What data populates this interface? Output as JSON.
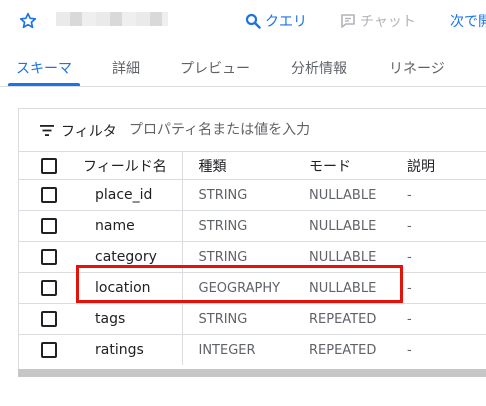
{
  "toolbar": {
    "query_label": "クエリ",
    "chat_label": "チャット",
    "next_label": "次で開く"
  },
  "tabs": [
    {
      "label": "スキーマ",
      "active": true
    },
    {
      "label": "詳細",
      "active": false
    },
    {
      "label": "プレビュー",
      "active": false
    },
    {
      "label": "分析情報",
      "active": false
    },
    {
      "label": "リネージ",
      "active": false
    }
  ],
  "filter": {
    "label": "フィルタ",
    "placeholder": "プロパティ名または値を入力"
  },
  "table": {
    "headers": {
      "name": "フィールド名",
      "type": "種類",
      "mode": "モード",
      "description": "説明"
    },
    "rows": [
      {
        "name": "place_id",
        "type": "STRING",
        "mode": "NULLABLE",
        "description": "-"
      },
      {
        "name": "name",
        "type": "STRING",
        "mode": "NULLABLE",
        "description": "-"
      },
      {
        "name": "category",
        "type": "STRING",
        "mode": "NULLABLE",
        "description": "-"
      },
      {
        "name": "location",
        "type": "GEOGRAPHY",
        "mode": "NULLABLE",
        "description": "-"
      },
      {
        "name": "tags",
        "type": "STRING",
        "mode": "REPEATED",
        "description": "-"
      },
      {
        "name": "ratings",
        "type": "INTEGER",
        "mode": "REPEATED",
        "description": "-"
      }
    ]
  },
  "highlighted_row": "location",
  "colors": {
    "accent": "#1a73e8",
    "highlight": "#e3120b",
    "disabled": "#b0b3b8"
  },
  "icons": {
    "star": "star-outline-icon",
    "query": "search-icon",
    "chat": "chat-icon",
    "filter": "filter-list-icon"
  }
}
